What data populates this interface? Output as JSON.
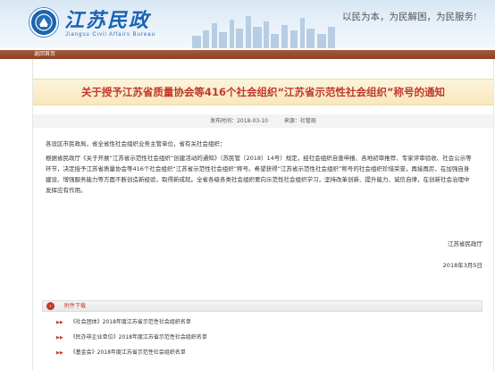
{
  "header": {
    "brand_cn": "江苏民政",
    "brand_en": "Jiangsu Civil Affairs Bureau",
    "slogan": "以民为本，为民解困，为民服务!"
  },
  "nav": {
    "back_label": "返回首页"
  },
  "article": {
    "title": "关于授予江苏省质量协会等416个社会组织“江苏省示范性社会组织”称号的通知",
    "publish_date_label": "发布时间：2018-03-10",
    "source_label": "来源：社管局",
    "greeting": "各设区市民政局，省全省性社会组织业务主管单位，省有关社会组织：",
    "body": "根据省民政厅《关于开展“江苏省示范性社会组织”创建活动的通知》（苏民管〔2018〕14号）规定，经社会组织自查申报、各地初审推荐、专家评审验收、社会公示等环节，决定授予江苏省质量协会等416个社会组织“江苏省示范性社会组织”称号。希望获得“江苏省示范性社会组织”称号的社会组织珍惜荣誉，再接再厉，在加强自身建设、增强服务能力等方面不断创造新经验，取得新成就。全省各级各类社会组织要向示范性社会组织学习，坚持改革创新、提升能力、诚信自律，在创新社会治理中发挥应有作用。",
    "sign_org": "江苏省民政厅",
    "sign_date": "2018年3月5日"
  },
  "attachments": {
    "label": "附件下载",
    "items": [
      "《社会团体》2018年度江苏省示范性社会组织名单",
      "《民办非企业单位》2018年度江苏省示范性社会组织名单",
      "《基金会》2018年度江苏省示范性社会组织名单"
    ]
  },
  "colors": {
    "title_red": "#c0392b",
    "brand_blue": "#1a63b3",
    "nav_brown": "#8c4026"
  },
  "icons": [
    "emblem-logo-icon",
    "city-skyline-icon",
    "attachment-icon",
    "arrow-bullet-icon"
  ]
}
